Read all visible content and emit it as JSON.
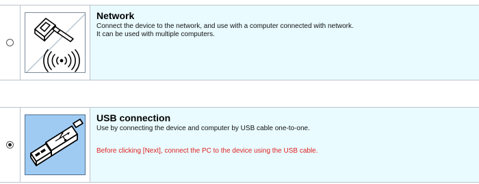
{
  "options": [
    {
      "id": "network",
      "selected": false,
      "icon": "ethernet-wireless-icon",
      "title": "Network",
      "description_lines": [
        "Connect the device to the network, and use with a computer connected with network.",
        "It can be used with multiple computers."
      ],
      "warning": ""
    },
    {
      "id": "usb",
      "selected": true,
      "icon": "usb-plug-icon",
      "title": "USB connection",
      "description_lines": [
        "Use by connecting the device and computer by USB cable one-to-one."
      ],
      "warning": "Before clicking [Next], connect the PC to the device using the USB cable."
    }
  ],
  "colors": {
    "text_background": "#e9fbff",
    "usb_icon_background": "#9fcbf3",
    "warning_text": "#e02020",
    "border": "#b9c3cc"
  }
}
